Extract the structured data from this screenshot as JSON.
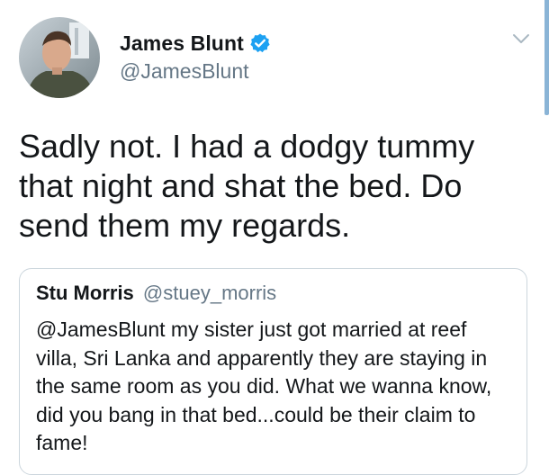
{
  "tweet": {
    "author": {
      "display_name": "James Blunt",
      "handle": "@JamesBlunt",
      "verified": true,
      "avatar_icon": "profile-photo"
    },
    "text": "Sadly not. I had a dodgy tummy that night and shat the bed. Do send them my regards.",
    "menu_icon": "chevron-down-icon"
  },
  "quoted_tweet": {
    "display_name": "Stu Morris",
    "handle": "@stuey_morris",
    "text": "@JamesBlunt my sister just got married at reef villa, Sri Lanka and apparently they are staying in the same room as you did. What we wanna know, did you bang in that bed...could be their claim to fame!"
  },
  "colors": {
    "verified_badge": "#1da1f2",
    "secondary_text": "#657786",
    "primary_text": "#14171a",
    "card_border": "#ccd6dd"
  }
}
